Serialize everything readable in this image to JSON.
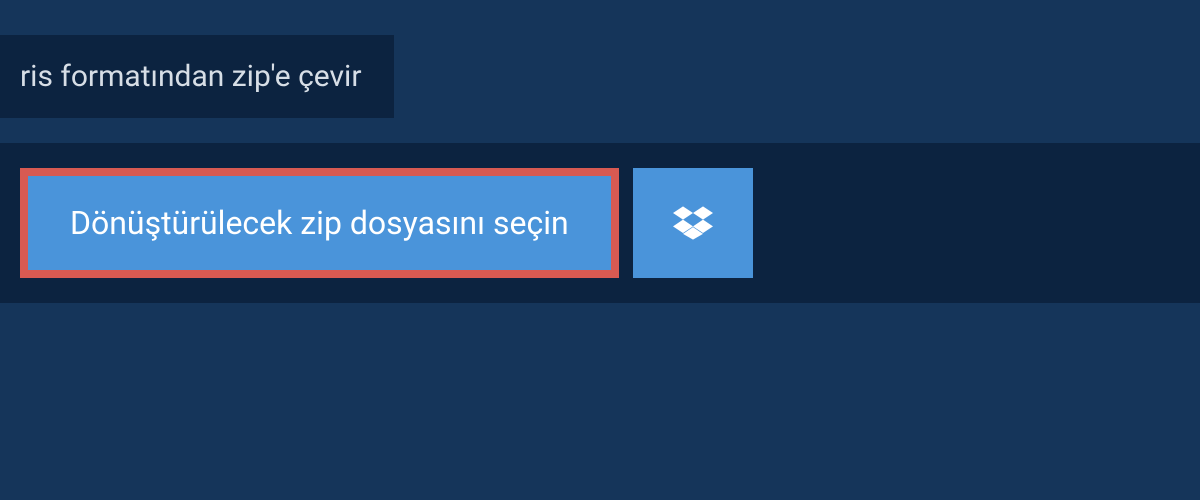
{
  "header": {
    "title": "ris formatından zip'e çevir"
  },
  "panel": {
    "select_file_label": "Dönüştürülecek zip dosyasını seçin"
  },
  "colors": {
    "background": "#15355a",
    "panel": "#0c2340",
    "button": "#4a94da",
    "highlight_border": "#d85a52",
    "text_light": "#d7dee6",
    "text_white": "#ffffff"
  }
}
